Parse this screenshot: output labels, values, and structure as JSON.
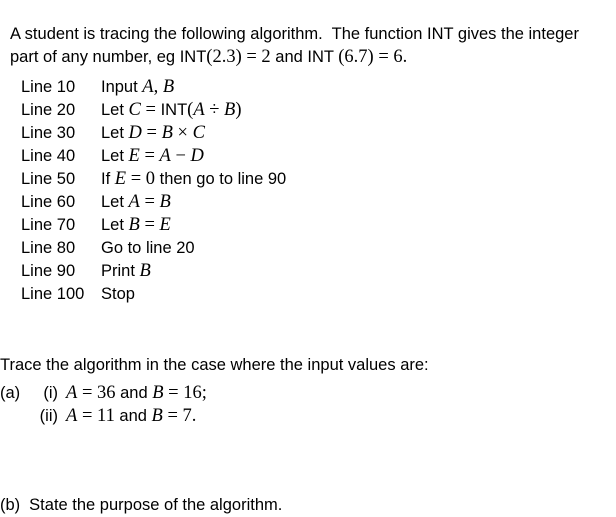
{
  "document": {
    "background_color": "#ffffff",
    "text_color": "#000000"
  },
  "intro": {
    "sentence1": "A student is tracing the following algorithm.",
    "sentence2_part1": "The function INT gives the integer part of any number, eg INT",
    "example1_arg": "(2.3)",
    "equals1": "=",
    "example1_value": "2",
    "conjunction": "and",
    "function_name2": "INT",
    "example2_arg": "(6.7)",
    "equals2": "=",
    "example2_value": "6."
  },
  "algorithm": {
    "lines": [
      {
        "label": "Line 10",
        "keyword": "Input",
        "var1": "A",
        "separator": ",",
        "var2": "B"
      },
      {
        "label": "Line 20",
        "keyword": "Let",
        "target": "C",
        "equals": "=",
        "func": "INT",
        "open": "(",
        "operand1": "A",
        "operator": "÷",
        "operand2": "B",
        "close": ")"
      },
      {
        "label": "Line 30",
        "keyword": "Let",
        "target": "D",
        "equals": "=",
        "operand1": "B",
        "operator": "×",
        "operand2": "C"
      },
      {
        "label": "Line 40",
        "keyword": "Let",
        "target": "E",
        "equals": "=",
        "operand1": "A",
        "operator": "−",
        "operand2": "D"
      },
      {
        "label": "Line 50",
        "keyword": "If",
        "target": "E",
        "equals": "=",
        "value": "0",
        "tail": "then go to line 90"
      },
      {
        "label": "Line 60",
        "keyword": "Let",
        "target": "A",
        "equals": "=",
        "operand1": "B"
      },
      {
        "label": "Line 70",
        "keyword": "Let",
        "target": "B",
        "equals": "=",
        "operand1": "E"
      },
      {
        "label": "Line 80",
        "keyword": "Go to line 20"
      },
      {
        "label": "Line 90",
        "keyword": "Print",
        "target": "B"
      },
      {
        "label": "Line 100",
        "keyword": "Stop"
      }
    ]
  },
  "trace_instruction": "Trace the algorithm in the case where the input values are:",
  "part_a": {
    "tag": "(a)",
    "items": [
      {
        "numeral": "(i)",
        "var1": "A",
        "eq1": "=",
        "val1": "36",
        "conj": "and",
        "var2": "B",
        "eq2": "=",
        "val2": "16;"
      },
      {
        "numeral": "(ii)",
        "var1": "A",
        "eq1": "=",
        "val1": "11",
        "conj": "and",
        "var2": "B",
        "eq2": "=",
        "val2": "7."
      }
    ]
  },
  "part_b": {
    "tag": "(b)",
    "text": "State the purpose of the algorithm."
  }
}
